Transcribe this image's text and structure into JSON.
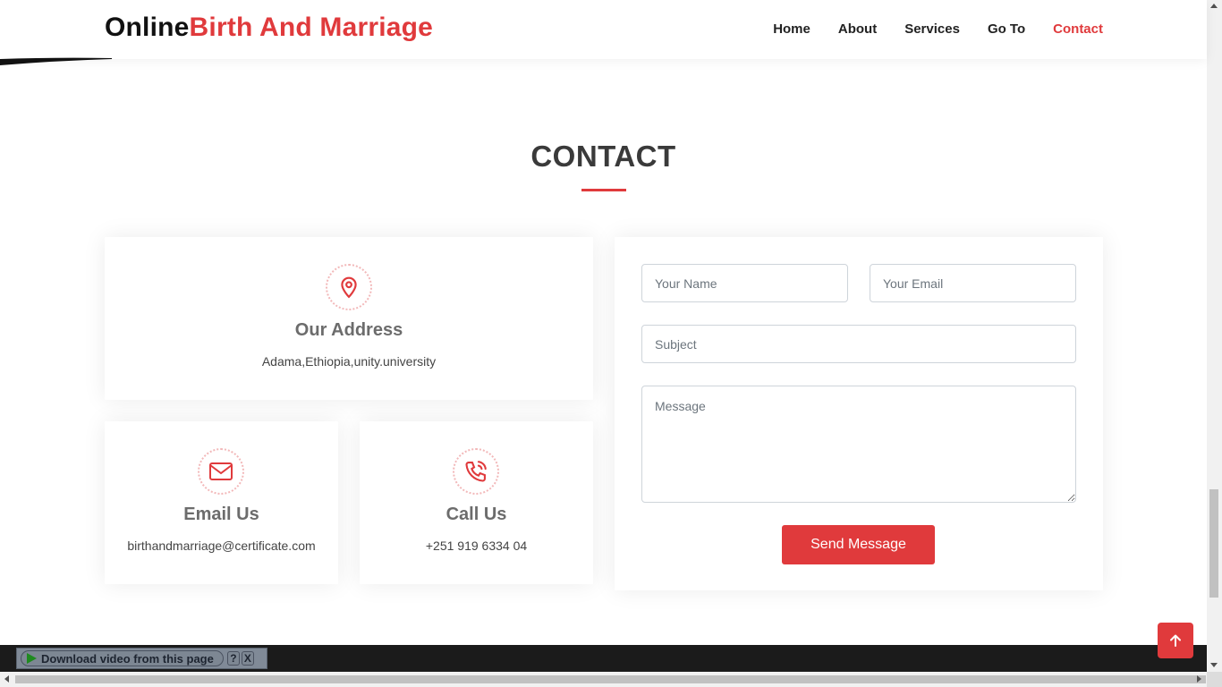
{
  "brand": {
    "part1": "Online",
    "part2": "Birth And Marriage",
    "accent_color": "#e03a3c"
  },
  "nav": {
    "items": [
      {
        "label": "Home",
        "active": false
      },
      {
        "label": "About",
        "active": false
      },
      {
        "label": "Services",
        "active": false
      },
      {
        "label": "Go To",
        "active": false
      },
      {
        "label": "Contact",
        "active": true
      }
    ]
  },
  "section": {
    "title": "CONTACT"
  },
  "address": {
    "icon": "map-pin-icon",
    "title": "Our Address",
    "text": "Adama,Ethiopia,unity.university"
  },
  "email": {
    "icon": "envelope-icon",
    "title": "Email Us",
    "text": "birthandmarriage@certificate.com"
  },
  "phone": {
    "icon": "phone-call-icon",
    "title": "Call Us",
    "text": "+251 919 6334 04"
  },
  "form": {
    "name_placeholder": "Your Name",
    "email_placeholder": "Your Email",
    "subject_placeholder": "Subject",
    "message_placeholder": "Message",
    "submit_label": "Send Message"
  },
  "download_bar": {
    "label": "Download video from this page",
    "help": "?",
    "close": "X"
  },
  "back_to_top": {
    "icon": "arrow-up-icon"
  }
}
